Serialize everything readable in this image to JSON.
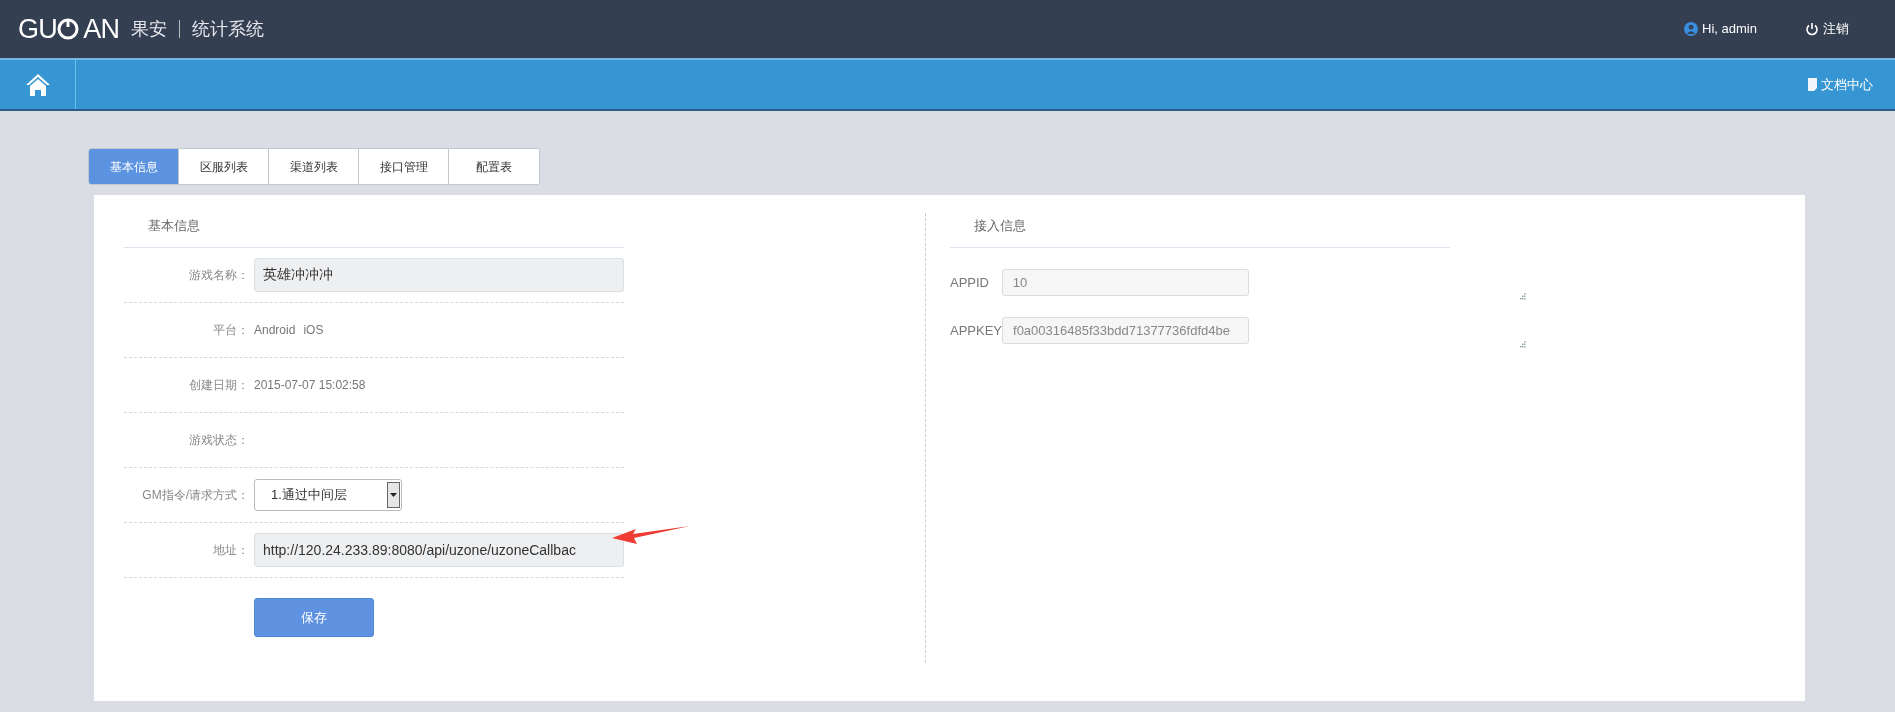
{
  "header": {
    "logo_start": "GU",
    "logo_end": "AN",
    "brand": "果安",
    "system": "统计系统",
    "user": "Hi, admin",
    "logout": "注销"
  },
  "nav": {
    "docs": "文档中心"
  },
  "tabs": [
    {
      "label": "基本信息",
      "selected": true
    },
    {
      "label": "区服列表",
      "selected": false
    },
    {
      "label": "渠道列表",
      "selected": false
    },
    {
      "label": "接口管理",
      "selected": false
    },
    {
      "label": "配置表",
      "selected": false
    }
  ],
  "basic_info": {
    "title": "基本信息",
    "rows": [
      {
        "kind": "input",
        "label": "游戏名称：",
        "value": "英雄冲冲冲"
      },
      {
        "kind": "list",
        "label": "平台：",
        "values": [
          "Android",
          "iOS"
        ]
      },
      {
        "kind": "text",
        "label": "创建日期：",
        "value": "2015-07-07 15:02:58"
      },
      {
        "kind": "text",
        "label": "游戏状态："
      },
      {
        "kind": "select",
        "label": "GM指令/请求方式：",
        "value": "1.通过中间层"
      },
      {
        "kind": "input",
        "label": "地址：",
        "value": "http://120.24.233.89:8080/api/uzone/uzoneCallbac"
      }
    ],
    "save": "保存"
  },
  "access_info": {
    "title": "接入信息",
    "rows": [
      {
        "label": "APPID",
        "value": "10"
      },
      {
        "label": "APPKEY",
        "value": "f0a00316485f33bdd71377736fdfd4be"
      }
    ]
  }
}
